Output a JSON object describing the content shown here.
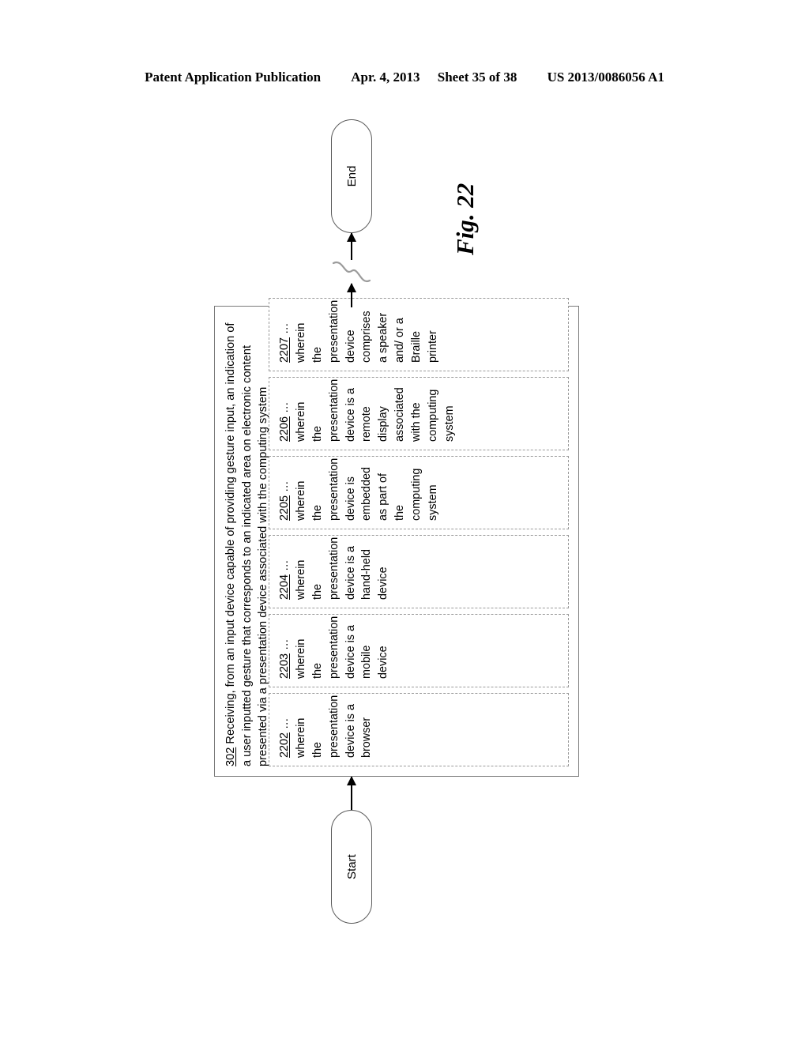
{
  "header": {
    "publication": "Patent Application Publication",
    "date": "Apr. 4, 2013",
    "sheet": "Sheet 35 of 38",
    "doc_number": "US 2013/0086056 A1"
  },
  "figure": {
    "caption": "Fig. 22"
  },
  "flowchart": {
    "start_label": "Start",
    "end_label": "End",
    "step": {
      "number": "302",
      "text": " Receiving, from an input device capable of providing gesture input, an indication of a user inputted gesture that corresponds to an indicated area on electronic content presented via a presentation device associated with the computing system"
    },
    "sub_steps": [
      {
        "number": "2202",
        "ellipsis": "…",
        "text": "wherein the presentation device is a browser"
      },
      {
        "number": "2203",
        "ellipsis": "…",
        "text": "wherein the presentation device is a mobile device"
      },
      {
        "number": "2204",
        "ellipsis": "…",
        "text": "wherein the presentation device is a hand-held device"
      },
      {
        "number": "2205",
        "ellipsis": "…",
        "text": "wherein the presentation device is embedded as part of the computing system"
      },
      {
        "number": "2206",
        "ellipsis": "…",
        "text": "wherein the presentation device is a remote display associated with the computing system"
      },
      {
        "number": "2207",
        "ellipsis": "…",
        "text": "wherein the presentation device comprises a speaker and/ or a Braille printer"
      }
    ]
  }
}
